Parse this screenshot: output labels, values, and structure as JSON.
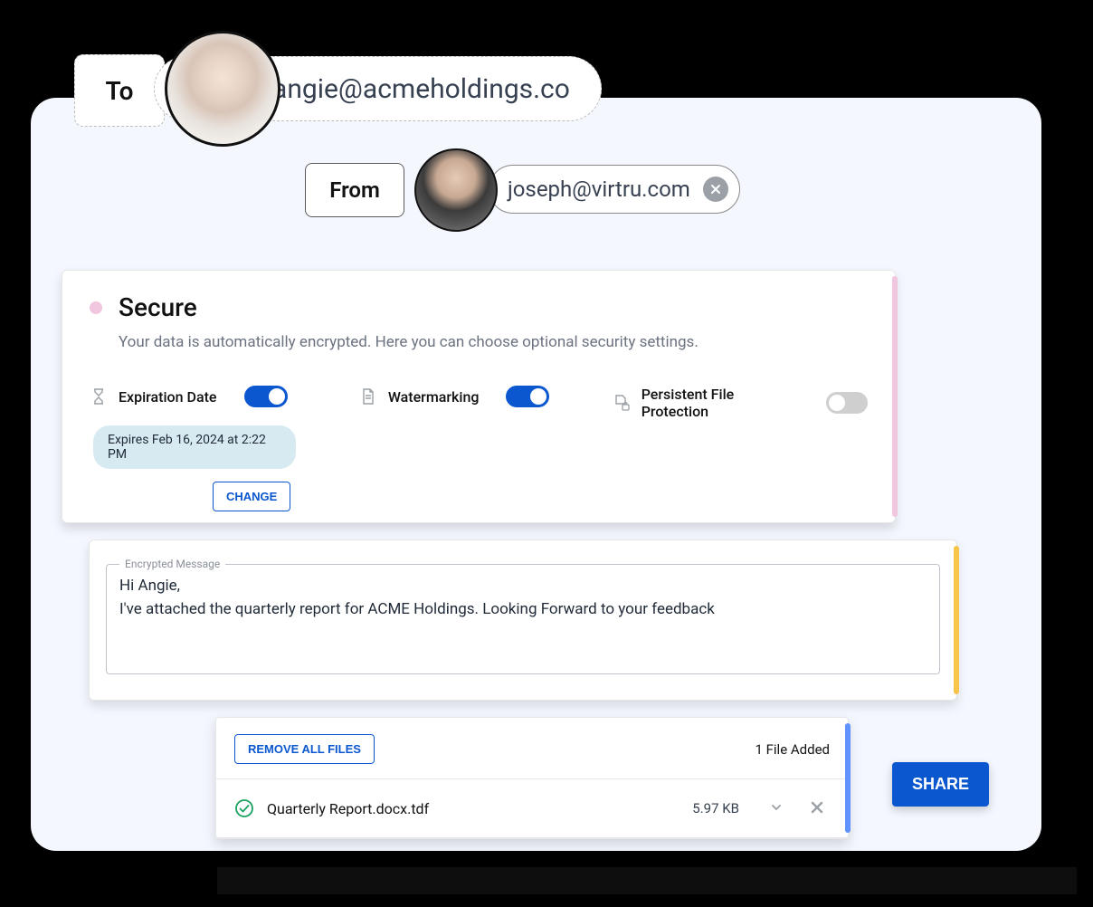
{
  "to": {
    "label": "To",
    "email": "angie@acmeholdings.co"
  },
  "from": {
    "label": "From",
    "email": "joseph@virtru.com"
  },
  "secure": {
    "title": "Secure",
    "description": "Your data is automatically encrypted. Here you can choose optional security settings.",
    "expiration": {
      "label": "Expiration Date",
      "enabled": true,
      "text": "Expires Feb 16, 2024 at 2:22 PM",
      "change_label": "CHANGE"
    },
    "watermarking": {
      "label": "Watermarking",
      "enabled": true
    },
    "pfp": {
      "label": "Persistent File Protection",
      "enabled": false
    }
  },
  "message": {
    "legend": "Encrypted Message",
    "body": "Hi Angie,\nI've attached the quarterly report for ACME Holdings. Looking Forward to your feedback"
  },
  "files": {
    "remove_all_label": "REMOVE ALL FILES",
    "count_text": "1 File Added",
    "items": [
      {
        "name": "Quarterly Report.docx.tdf",
        "size": "5.97 KB"
      }
    ]
  },
  "share_label": "SHARE"
}
